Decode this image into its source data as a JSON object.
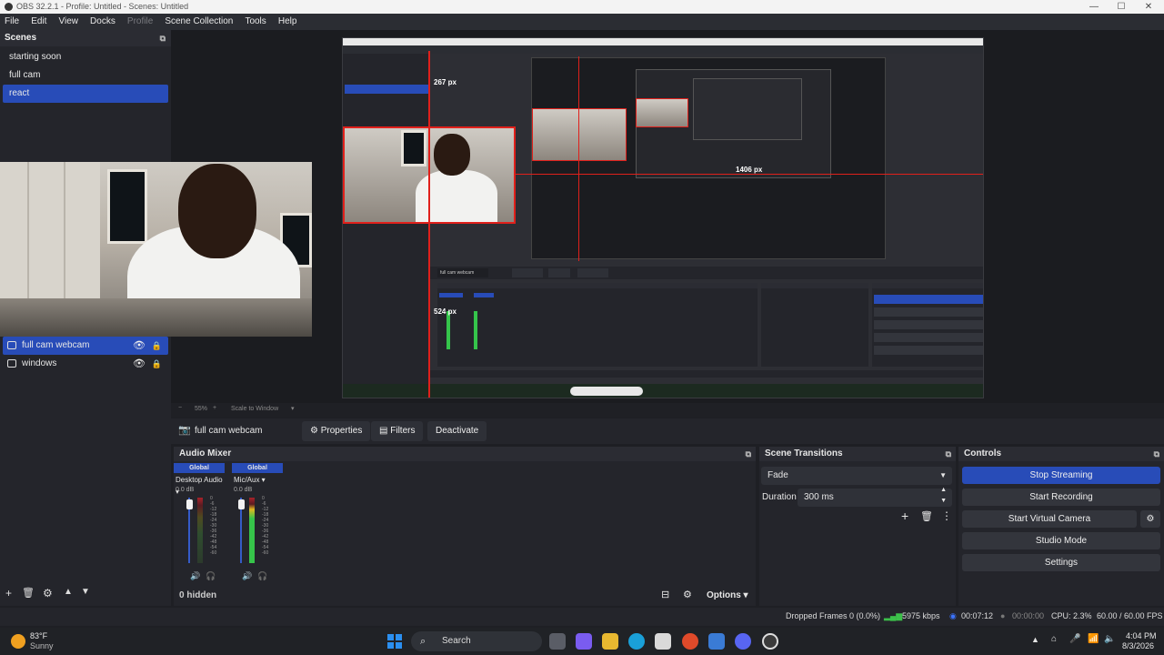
{
  "window": {
    "title": "OBS 32.2.1 - Profile: Untitled - Scenes: Untitled",
    "minimize": "—",
    "maximize": "☐",
    "close": "✕"
  },
  "menu": [
    "File",
    "Edit",
    "View",
    "Docks",
    "Profile",
    "Scene Collection",
    "Tools",
    "Help"
  ],
  "scenes": {
    "title": "Scenes",
    "items": [
      "starting soon",
      "full cam",
      "react"
    ],
    "active": "react"
  },
  "sources": {
    "items": [
      {
        "label": "full cam webcam",
        "active": true
      },
      {
        "label": "windows",
        "active": false
      }
    ]
  },
  "preview": {
    "width_label": "267 px",
    "height_label": "1406 px",
    "depth_label": "524 px"
  },
  "zoom": {
    "level": "55%",
    "mode": "Scale to Window"
  },
  "context_bar": {
    "source_name": "full cam webcam",
    "properties": "Properties",
    "filters": "Filters",
    "deactivate": "Deactivate"
  },
  "audio_mixer": {
    "title": "Audio Mixer",
    "channels": [
      {
        "scope": "Global",
        "name": "Desktop Audio",
        "db": "0.0 dB"
      },
      {
        "scope": "Global",
        "name": "Mic/Aux",
        "db": "0.0 dB"
      }
    ],
    "scale": [
      "0",
      "-6",
      "-12",
      "-18",
      "-24",
      "-30",
      "-36",
      "-42",
      "-48",
      "-54",
      "-60"
    ],
    "hidden": "0 hidden",
    "options": "Options"
  },
  "transitions": {
    "title": "Scene Transitions",
    "selected": "Fade",
    "duration_label": "Duration",
    "duration_value": "300 ms"
  },
  "controls": {
    "title": "Controls",
    "buttons": [
      "Stop Streaming",
      "Start Recording",
      "Start Virtual Camera",
      "Studio Mode",
      "Settings"
    ]
  },
  "status": {
    "dropped": "Dropped Frames 0 (0.0%)",
    "bitrate": "5975 kbps",
    "stream_time": "00:07:12",
    "rec_time": "00:00:00",
    "cpu": "CPU: 2.3%",
    "fps": "60.00 / 60.00 FPS"
  },
  "taskbar": {
    "temp": "83°F",
    "weather": "Sunny",
    "search": "Search",
    "time": "4:04 PM",
    "date": "8/3/2026"
  },
  "colors": {
    "accent": "#284cb8",
    "selection_red": "#e0201b",
    "panel": "#24252b",
    "background": "#1e1f24"
  }
}
